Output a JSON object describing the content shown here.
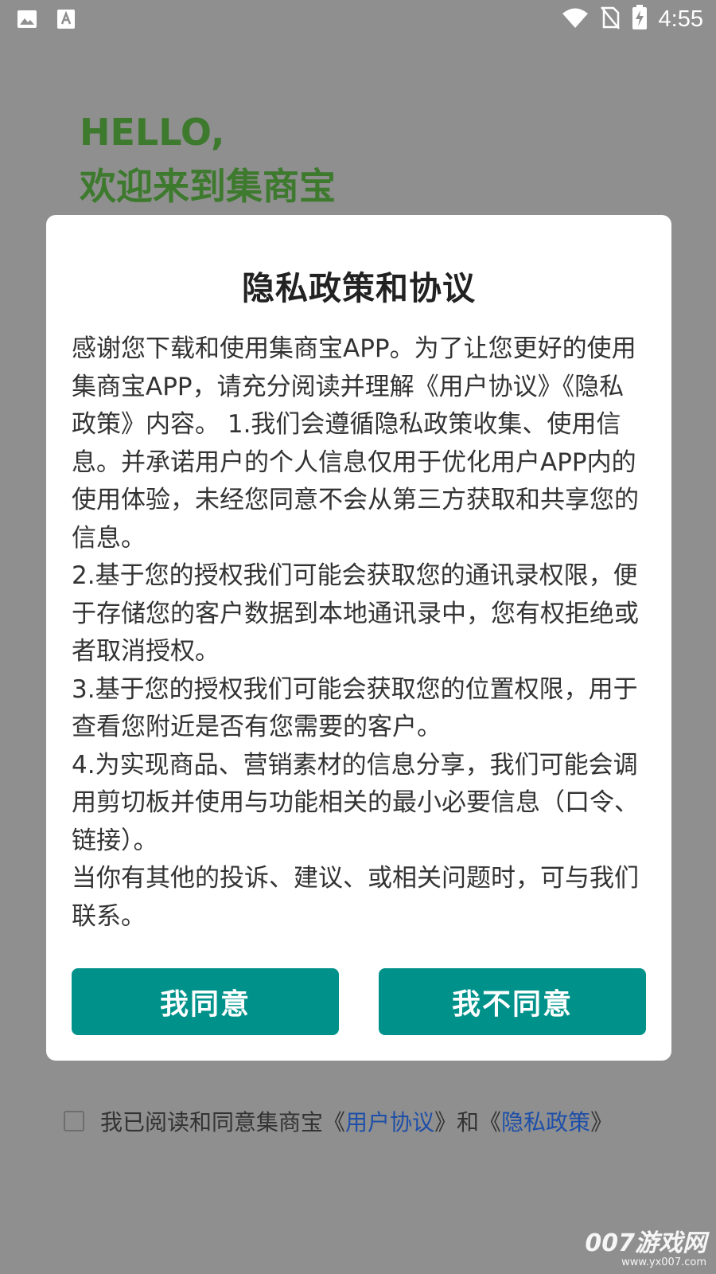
{
  "status_bar": {
    "time": "4:55",
    "left_icons": [
      "image-icon",
      "font-download-icon"
    ],
    "right_icons": [
      "wifi-icon",
      "no-sim-icon",
      "battery-charging-icon"
    ]
  },
  "welcome": {
    "line1": "HELLO,",
    "line2": "欢迎来到集商宝"
  },
  "dialog": {
    "title": "隐私政策和协议",
    "paragraphs": [
      "感谢您下载和使用集商宝APP。为了让您更好的使用集商宝APP，请充分阅读并理解《用户协议》《隐私政策》内容。 1.我们会遵循隐私政策收集、使用信息。并承诺用户的个人信息仅用于优化用户APP内的使用体验，未经您同意不会从第三方获取和共享您的信息。",
      "2.基于您的授权我们可能会获取您的通讯录权限，便于存储您的客户数据到本地通讯录中，您有权拒绝或者取消授权。",
      "3.基于您的授权我们可能会获取您的位置权限，用于查看您附近是否有您需要的客户。",
      "4.为实现商品、营销素材的信息分享，我们可能会调用剪切板并使用与功能相关的最小必要信息（口令、链接）。",
      "当你有其他的投诉、建议、或相关问题时，可与我们联系。"
    ],
    "agree_label": "我同意",
    "disagree_label": "我不同意"
  },
  "consent": {
    "prefix": "我已阅读和同意集商宝《",
    "link1": "用户协议",
    "middle": "》和《",
    "link2": "隐私政策",
    "suffix": "》"
  },
  "watermark": {
    "title": "007游戏网",
    "url": "www.yx007.com"
  },
  "colors": {
    "overlay_background": "#8f8f8f",
    "welcome_text": "#3d7a2e",
    "button": "#00928a",
    "link": "#1e4fa8"
  }
}
